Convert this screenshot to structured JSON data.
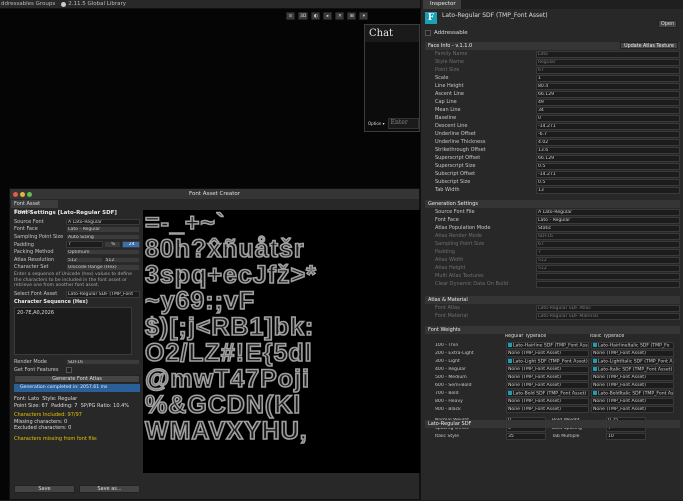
{
  "topbar": {
    "left_label": "ddressables Groups",
    "badge": "2.11.5 Global Library"
  },
  "scene_toolbar": {
    "items": [
      "⊙",
      "3D",
      "◐",
      "▸",
      "✕",
      "⊞",
      "▾"
    ]
  },
  "chat": {
    "title": "Chat",
    "option": "Option",
    "input_placeholder": "Enter"
  },
  "font_asset_creator": {
    "window_title": "Font Asset Creator",
    "tab": "Font Asset Creator",
    "header": "Font Settings [Lato-Regular SDF]",
    "fields": [
      {
        "label": "Source Font",
        "value": "A Lato-Regular"
      },
      {
        "label": "Font Face",
        "value": "Lato - Regular"
      },
      {
        "label": "Sampling Point Size",
        "value": "Auto Sizing"
      },
      {
        "label": "Packing Method",
        "value": "Optimum"
      },
      {
        "label": "Character Set",
        "value": "Unicode Range (Hex)"
      }
    ],
    "padding": {
      "label": "Padding",
      "value": "7",
      "pct": "%",
      "value2": "24"
    },
    "atlas_resolution": {
      "label": "Atlas Resolution",
      "w": "512",
      "h": "512"
    },
    "note": "Enter a sequence of Unicode (hex) values to define the characters to be included in the font asset or retrieve one from another font asset.",
    "select_font_asset": {
      "label": "Select Font Asset",
      "value": "Lato-Regular SDF (TMP_Font"
    },
    "char_seq_label": "Character Sequence (Hex)",
    "char_seq": "20-7E,A0,2026",
    "render_mode": {
      "label": "Render Mode",
      "value": "SDF16"
    },
    "get_features": "Get Font Features",
    "generate_btn": "Generate Font Atlas",
    "status": "Generation completed in: 2057.61 ms",
    "stats": {
      "font": "Font: Lato",
      "style": "Style: Regular",
      "point_size": "Point Size: 67",
      "padding": "Padding: 7",
      "ratio": "SP/PG Ratio: 10.4%",
      "chars_included": "Characters Included: 97/97",
      "missing": "Missing characters: 0",
      "excluded": "Excluded characters: 0",
      "missing_header": "Characters missing from font file:"
    },
    "save": "Save",
    "save_as": "Save as...",
    "atlas_lines": [
      "=-_+~`",
      "80h?x̂ñuåtšr",
      "3spq+ecJfž>*",
      "~y69:;vF",
      "$)[;j<RB1]bk:",
      "O2/LZ#!E{5dl",
      "@mwT47Poji",
      "%&GCDN(Kl",
      "WMAVXYHU,"
    ]
  },
  "inspector": {
    "tab": "Inspector",
    "title": "Lato-Regular SDF (TMP_Font Asset)",
    "open": "Open",
    "addressable": "Addressable",
    "face_info": {
      "header": "Face Info - v.1.1.0",
      "update_btn": "Update Atlas Texture",
      "rows": [
        {
          "label": "Family Name",
          "value": "Lato",
          "dim": true
        },
        {
          "label": "Style Name",
          "value": "Regular",
          "dim": true
        },
        {
          "label": "Point Size",
          "value": "67",
          "dim": true
        },
        {
          "label": "Scale",
          "value": "1"
        },
        {
          "label": "Line Height",
          "value": "80.4"
        },
        {
          "label": "Ascent Line",
          "value": "66.129"
        },
        {
          "label": "Cap Line",
          "value": "49"
        },
        {
          "label": "Mean Line",
          "value": "34"
        },
        {
          "label": "Baseline",
          "value": "0"
        },
        {
          "label": "Descent Line",
          "value": "-14.271"
        },
        {
          "label": "Underline Offset",
          "value": "-6.7"
        },
        {
          "label": "Underline Thickness",
          "value": "4.02"
        },
        {
          "label": "Strikethrough Offset",
          "value": "13.6"
        },
        {
          "label": "Superscript Offset",
          "value": "66.129"
        },
        {
          "label": "Superscript Size",
          "value": "0.5"
        },
        {
          "label": "Subscript Offset",
          "value": "-14.271"
        },
        {
          "label": "Subscript Size",
          "value": "0.5"
        },
        {
          "label": "Tab Width",
          "value": "13"
        }
      ]
    },
    "generation": {
      "header": "Generation Settings",
      "rows": [
        {
          "label": "Source Font File",
          "value": "A Lato-Regular"
        },
        {
          "label": "Font Face",
          "value": "Lato - Regular"
        },
        {
          "label": "Atlas Population Mode",
          "value": "Static"
        },
        {
          "label": "Atlas Render Mode",
          "value": "SDF16",
          "dim": true
        },
        {
          "label": "Sampling Point Size",
          "value": "67",
          "dim": true
        },
        {
          "label": "Padding",
          "value": "7",
          "dim": true
        },
        {
          "label": "Atlas Width",
          "value": "512",
          "dim": true
        },
        {
          "label": "Atlas Height",
          "value": "512",
          "dim": true
        },
        {
          "label": "Multi Atlas Textures",
          "value": "",
          "dim": true
        },
        {
          "label": "Clear Dynamic Data On Build",
          "value": "",
          "dim": true
        }
      ]
    },
    "atlas_material": {
      "header": "Atlas & Material",
      "rows": [
        {
          "label": "Font Atlas",
          "value": "Lato-Regular SDF Atlas",
          "dim": true
        },
        {
          "label": "Font Material",
          "value": "Lato-Regular SDF Material",
          "dim": true
        }
      ]
    },
    "font_weights": {
      "header": "Font Weights",
      "col1": "Regular Typeface",
      "col2": "Italic Typeface",
      "rows": [
        {
          "label": "100 - Thin",
          "regular": "Lato-Hairline SDF (TMP_Font Asset",
          "italic": "Lato-HairlineItalic SDF (TMP_Fo"
        },
        {
          "label": "200 - Extra-Light",
          "regular": "None (TMP_Font Asset)",
          "italic": "None (TMP_Font Asset)"
        },
        {
          "label": "300 - Light",
          "regular": "Lato-Light SDF (TMP_Font Asset)",
          "italic": "Lato-LightItalic SDF (TMP_Font A"
        },
        {
          "label": "400 - Regular",
          "regular": "None (TMP_Font Asset)",
          "italic": "Lato-Italic SDF (TMP_Font Asset)"
        },
        {
          "label": "500 - Medium",
          "regular": "None (TMP_Font Asset)",
          "italic": "None (TMP_Font Asset)"
        },
        {
          "label": "600 - Semi-Bold",
          "regular": "None (TMP_Font Asset)",
          "italic": "None (TMP_Font Asset)"
        },
        {
          "label": "700 - Bold",
          "regular": "Lato-Bold SDF (TMP_Font Asset)",
          "italic": "Lato-BoldItalic SDF (TMP_Font As"
        },
        {
          "label": "800 - Heavy",
          "regular": "None (TMP_Font Asset)",
          "italic": "None (TMP_Font Asset)"
        },
        {
          "label": "900 - Black",
          "regular": "None (TMP_Font Asset)",
          "italic": "None (TMP_Font Asset)"
        }
      ],
      "bottom": [
        {
          "l1": "Normal Weight",
          "v1": "0",
          "l2": "Bold Weight",
          "v2": "0.75"
        },
        {
          "l1": "Spacing Offset",
          "v1": "0",
          "l2": "Bold Spacing",
          "v2": "7"
        },
        {
          "l1": "Italic Style",
          "v1": "35",
          "l2": "Tab Multiple",
          "v2": "10"
        }
      ]
    },
    "footer": "Lato-Regular SDF"
  },
  "colors": {
    "accent_blue": "#2a5f98",
    "icon_teal": "#1aa0b5",
    "warning_yellow": "#e6c200"
  }
}
